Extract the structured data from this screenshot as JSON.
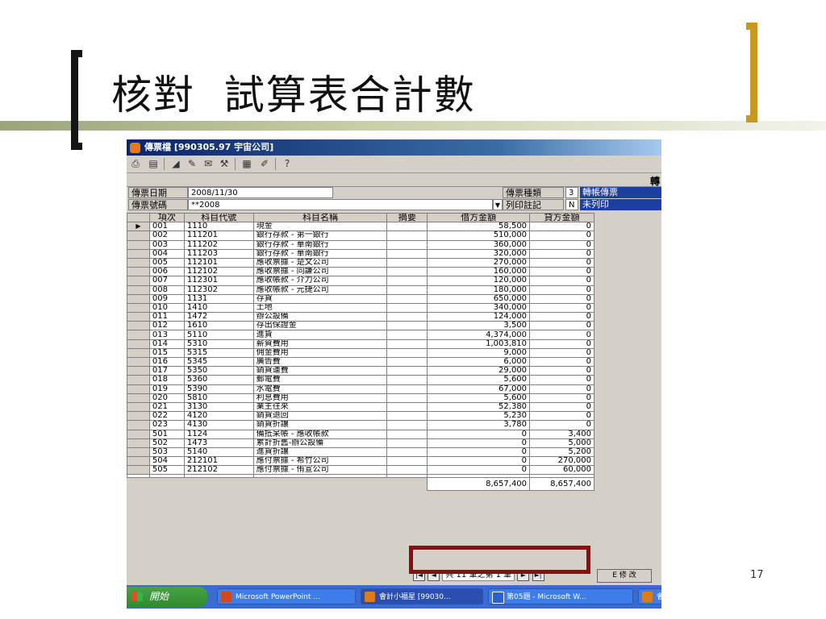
{
  "slide": {
    "title": "核對  試算表合計數",
    "page_number": "17",
    "accent_colors": {
      "left_bracket": "#141414",
      "right_bracket": "#c8991e",
      "rule": "#9aa57a"
    }
  },
  "window": {
    "title": "傳票檔 [990305.97 宇宙公司]",
    "toolbar_icons": [
      "print-icon",
      "preview-icon",
      "chart-icon",
      "pen-icon",
      "mail-icon",
      "tool-icon",
      "calc-icon",
      "edit-icon",
      "help-icon"
    ],
    "band_label": "轉",
    "form": {
      "date_label": "傳票日期",
      "date_value": "2008/11/30",
      "number_label": "傳票號碼",
      "number_value": "**2008",
      "type_label": "傳票種類",
      "type_value": "3",
      "type_name": "轉帳傳票",
      "print_label": "列印註記",
      "print_value": "N",
      "print_status": "未列印"
    },
    "grid": {
      "headers": [
        "項次",
        "科目代號",
        "科目名稱",
        "摘要",
        "借方金額",
        "貸方金額"
      ],
      "rows": [
        [
          "001",
          "1110",
          "現金",
          "",
          "58,500",
          "0"
        ],
        [
          "002",
          "111201",
          "銀行存款 - 第一銀行",
          "",
          "510,000",
          "0"
        ],
        [
          "003",
          "111202",
          "銀行存款 - 華南銀行",
          "",
          "360,000",
          "0"
        ],
        [
          "004",
          "111203",
          "銀行存款 - 華南銀行",
          "",
          "320,000",
          "0"
        ],
        [
          "005",
          "112101",
          "應收票據 - 楚文公司",
          "",
          "270,000",
          "0"
        ],
        [
          "006",
          "112102",
          "應收票據 - 同謙公司",
          "",
          "160,000",
          "0"
        ],
        [
          "007",
          "112301",
          "應收帳款 - 介力公司",
          "",
          "120,000",
          "0"
        ],
        [
          "008",
          "112302",
          "應收帳款 - 元捷公司",
          "",
          "180,000",
          "0"
        ],
        [
          "009",
          "1131",
          "存貨",
          "",
          "650,000",
          "0"
        ],
        [
          "010",
          "1410",
          "土地",
          "",
          "340,000",
          "0"
        ],
        [
          "011",
          "1472",
          "辦公設備",
          "",
          "124,000",
          "0"
        ],
        [
          "012",
          "1610",
          "存出保證金",
          "",
          "3,500",
          "0"
        ],
        [
          "013",
          "5110",
          "進貨",
          "",
          "4,374,000",
          "0"
        ],
        [
          "014",
          "5310",
          "薪資費用",
          "",
          "1,003,810",
          "0"
        ],
        [
          "015",
          "5315",
          "佣金費用",
          "",
          "9,000",
          "0"
        ],
        [
          "016",
          "5345",
          "廣告費",
          "",
          "6,000",
          "0"
        ],
        [
          "017",
          "5350",
          "銷貨運費",
          "",
          "29,000",
          "0"
        ],
        [
          "018",
          "5360",
          "郵電費",
          "",
          "5,600",
          "0"
        ],
        [
          "019",
          "5390",
          "水電費",
          "",
          "67,000",
          "0"
        ],
        [
          "020",
          "5810",
          "利息費用",
          "",
          "5,600",
          "0"
        ],
        [
          "021",
          "3130",
          "業主往來",
          "",
          "52,380",
          "0"
        ],
        [
          "022",
          "4120",
          "銷貨退回",
          "",
          "5,230",
          "0"
        ],
        [
          "023",
          "4130",
          "銷貨折讓",
          "",
          "3,780",
          "0"
        ],
        [
          "501",
          "1124",
          "備抵呆帳 - 應收帳款",
          "",
          "0",
          "3,400"
        ],
        [
          "502",
          "1473",
          "累計折舊-辦公設備",
          "",
          "0",
          "5,000"
        ],
        [
          "503",
          "5140",
          "進貨折讓",
          "",
          "0",
          "5,200"
        ],
        [
          "504",
          "212101",
          "應付票據 - 希竹公司",
          "",
          "0",
          "270,000"
        ],
        [
          "505",
          "212102",
          "應付票據 - 侑宣公司",
          "",
          "0",
          "60,000"
        ]
      ],
      "total_debit": "8,657,400",
      "total_credit": "8,657,400"
    },
    "navigator": {
      "first": "|◄",
      "prev": "◄",
      "text": "共 11 筆之第 1 筆",
      "next": "►",
      "last": "►|"
    },
    "edit_button": "E 修 改",
    "taskbar": {
      "start_label": "開始",
      "tasks": [
        "Microsoft PowerPoint ...",
        "會計小福星 [99030...",
        "第05題 - Microsoft W...",
        "會"
      ]
    }
  }
}
